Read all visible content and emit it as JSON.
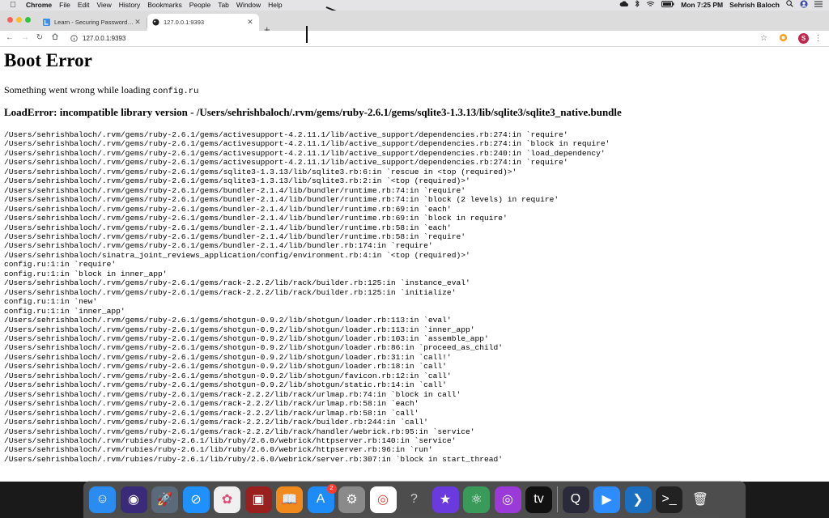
{
  "menubar": {
    "app_name": "Chrome",
    "items": [
      "File",
      "Edit",
      "View",
      "History",
      "Bookmarks",
      "People",
      "Tab",
      "Window",
      "Help"
    ],
    "clock": "Mon 7:25 PM",
    "user": "Sehrish Baloch"
  },
  "tabs": [
    {
      "title": "Learn - Securing Passwords in S",
      "active": false
    },
    {
      "title": "127.0.0.1:9393",
      "active": true
    }
  ],
  "toolbar": {
    "url": "127.0.0.1:9393",
    "profile_initial": "S"
  },
  "page": {
    "title": "Boot Error",
    "intro_text": "Something went wrong while loading ",
    "intro_file": "config.ru",
    "error_heading": "LoadError: incompatible library version - /Users/sehrishbaloch/.rvm/gems/ruby-2.6.1/gems/sqlite3-1.3.13/lib/sqlite3/sqlite3_native.bundle",
    "backtrace": [
      "/Users/sehrishbaloch/.rvm/gems/ruby-2.6.1/gems/activesupport-4.2.11.1/lib/active_support/dependencies.rb:274:in `require'",
      "/Users/sehrishbaloch/.rvm/gems/ruby-2.6.1/gems/activesupport-4.2.11.1/lib/active_support/dependencies.rb:274:in `block in require'",
      "/Users/sehrishbaloch/.rvm/gems/ruby-2.6.1/gems/activesupport-4.2.11.1/lib/active_support/dependencies.rb:240:in `load_dependency'",
      "/Users/sehrishbaloch/.rvm/gems/ruby-2.6.1/gems/activesupport-4.2.11.1/lib/active_support/dependencies.rb:274:in `require'",
      "/Users/sehrishbaloch/.rvm/gems/ruby-2.6.1/gems/sqlite3-1.3.13/lib/sqlite3.rb:6:in `rescue in <top (required)>'",
      "/Users/sehrishbaloch/.rvm/gems/ruby-2.6.1/gems/sqlite3-1.3.13/lib/sqlite3.rb:2:in `<top (required)>'",
      "/Users/sehrishbaloch/.rvm/gems/ruby-2.6.1/gems/bundler-2.1.4/lib/bundler/runtime.rb:74:in `require'",
      "/Users/sehrishbaloch/.rvm/gems/ruby-2.6.1/gems/bundler-2.1.4/lib/bundler/runtime.rb:74:in `block (2 levels) in require'",
      "/Users/sehrishbaloch/.rvm/gems/ruby-2.6.1/gems/bundler-2.1.4/lib/bundler/runtime.rb:69:in `each'",
      "/Users/sehrishbaloch/.rvm/gems/ruby-2.6.1/gems/bundler-2.1.4/lib/bundler/runtime.rb:69:in `block in require'",
      "/Users/sehrishbaloch/.rvm/gems/ruby-2.6.1/gems/bundler-2.1.4/lib/bundler/runtime.rb:58:in `each'",
      "/Users/sehrishbaloch/.rvm/gems/ruby-2.6.1/gems/bundler-2.1.4/lib/bundler/runtime.rb:58:in `require'",
      "/Users/sehrishbaloch/.rvm/gems/ruby-2.6.1/gems/bundler-2.1.4/lib/bundler.rb:174:in `require'",
      "/Users/sehrishbaloch/sinatra_joint_reviews_application/config/environment.rb:4:in `<top (required)>'",
      "config.ru:1:in `require'",
      "config.ru:1:in `block in inner_app'",
      "/Users/sehrishbaloch/.rvm/gems/ruby-2.6.1/gems/rack-2.2.2/lib/rack/builder.rb:125:in `instance_eval'",
      "/Users/sehrishbaloch/.rvm/gems/ruby-2.6.1/gems/rack-2.2.2/lib/rack/builder.rb:125:in `initialize'",
      "config.ru:1:in `new'",
      "config.ru:1:in `inner_app'",
      "/Users/sehrishbaloch/.rvm/gems/ruby-2.6.1/gems/shotgun-0.9.2/lib/shotgun/loader.rb:113:in `eval'",
      "/Users/sehrishbaloch/.rvm/gems/ruby-2.6.1/gems/shotgun-0.9.2/lib/shotgun/loader.rb:113:in `inner_app'",
      "/Users/sehrishbaloch/.rvm/gems/ruby-2.6.1/gems/shotgun-0.9.2/lib/shotgun/loader.rb:103:in `assemble_app'",
      "/Users/sehrishbaloch/.rvm/gems/ruby-2.6.1/gems/shotgun-0.9.2/lib/shotgun/loader.rb:86:in `proceed_as_child'",
      "/Users/sehrishbaloch/.rvm/gems/ruby-2.6.1/gems/shotgun-0.9.2/lib/shotgun/loader.rb:31:in `call!'",
      "/Users/sehrishbaloch/.rvm/gems/ruby-2.6.1/gems/shotgun-0.9.2/lib/shotgun/loader.rb:18:in `call'",
      "/Users/sehrishbaloch/.rvm/gems/ruby-2.6.1/gems/shotgun-0.9.2/lib/shotgun/favicon.rb:12:in `call'",
      "/Users/sehrishbaloch/.rvm/gems/ruby-2.6.1/gems/shotgun-0.9.2/lib/shotgun/static.rb:14:in `call'",
      "/Users/sehrishbaloch/.rvm/gems/ruby-2.6.1/gems/rack-2.2.2/lib/rack/urlmap.rb:74:in `block in call'",
      "/Users/sehrishbaloch/.rvm/gems/ruby-2.6.1/gems/rack-2.2.2/lib/rack/urlmap.rb:58:in `each'",
      "/Users/sehrishbaloch/.rvm/gems/ruby-2.6.1/gems/rack-2.2.2/lib/rack/urlmap.rb:58:in `call'",
      "/Users/sehrishbaloch/.rvm/gems/ruby-2.6.1/gems/rack-2.2.2/lib/rack/builder.rb:244:in `call'",
      "/Users/sehrishbaloch/.rvm/gems/ruby-2.6.1/gems/rack-2.2.2/lib/rack/handler/webrick.rb:95:in `service'",
      "/Users/sehrishbaloch/.rvm/rubies/ruby-2.6.1/lib/ruby/2.6.0/webrick/httpserver.rb:140:in `service'",
      "/Users/sehrishbaloch/.rvm/rubies/ruby-2.6.1/lib/ruby/2.6.0/webrick/httpserver.rb:96:in `run'",
      "/Users/sehrishbaloch/.rvm/rubies/ruby-2.6.1/lib/ruby/2.6.0/webrick/server.rb:307:in `block in start_thread'"
    ]
  },
  "dock": {
    "apps": [
      {
        "name": "finder",
        "icon": "finder-icon",
        "bg": "#2a8cf0"
      },
      {
        "name": "siri",
        "icon": "siri-icon",
        "bg": "#3a2a7a"
      },
      {
        "name": "launchpad",
        "icon": "launchpad-icon",
        "bg": "#5a6a7a"
      },
      {
        "name": "safari",
        "icon": "safari-icon",
        "bg": "#1e90ff"
      },
      {
        "name": "photos",
        "icon": "photos-icon",
        "bg": "#f0f0f0"
      },
      {
        "name": "photo-booth",
        "icon": "photo-booth-icon",
        "bg": "#9a1f1f"
      },
      {
        "name": "books",
        "icon": "books-icon",
        "bg": "#f08a1c"
      },
      {
        "name": "app-store",
        "icon": "app-store-icon",
        "bg": "#1d8cf8",
        "badge": "2"
      },
      {
        "name": "system-preferences",
        "icon": "gear-icon",
        "bg": "#8a8a8a"
      },
      {
        "name": "chrome",
        "icon": "chrome-icon",
        "bg": "#ffffff"
      },
      {
        "name": "help",
        "icon": "question-icon",
        "bg": "transparent"
      },
      {
        "name": "imovie",
        "icon": "star-icon",
        "bg": "#6a3adf"
      },
      {
        "name": "atom",
        "icon": "atom-icon",
        "bg": "#3a9a5a"
      },
      {
        "name": "podcasts",
        "icon": "podcasts-icon",
        "bg": "#9a3ad8"
      },
      {
        "name": "apple-tv",
        "icon": "tv-icon",
        "bg": "#111111"
      },
      {
        "name": "quicktime",
        "icon": "quicktime-icon",
        "bg": "#2a2a3a"
      },
      {
        "name": "zoom",
        "icon": "zoom-icon",
        "bg": "#2d8cff"
      },
      {
        "name": "vscode",
        "icon": "vscode-icon",
        "bg": "#1a6fc0"
      },
      {
        "name": "terminal",
        "icon": "terminal-icon",
        "bg": "#222222"
      },
      {
        "name": "trash",
        "icon": "trash-icon",
        "bg": "transparent"
      }
    ]
  }
}
